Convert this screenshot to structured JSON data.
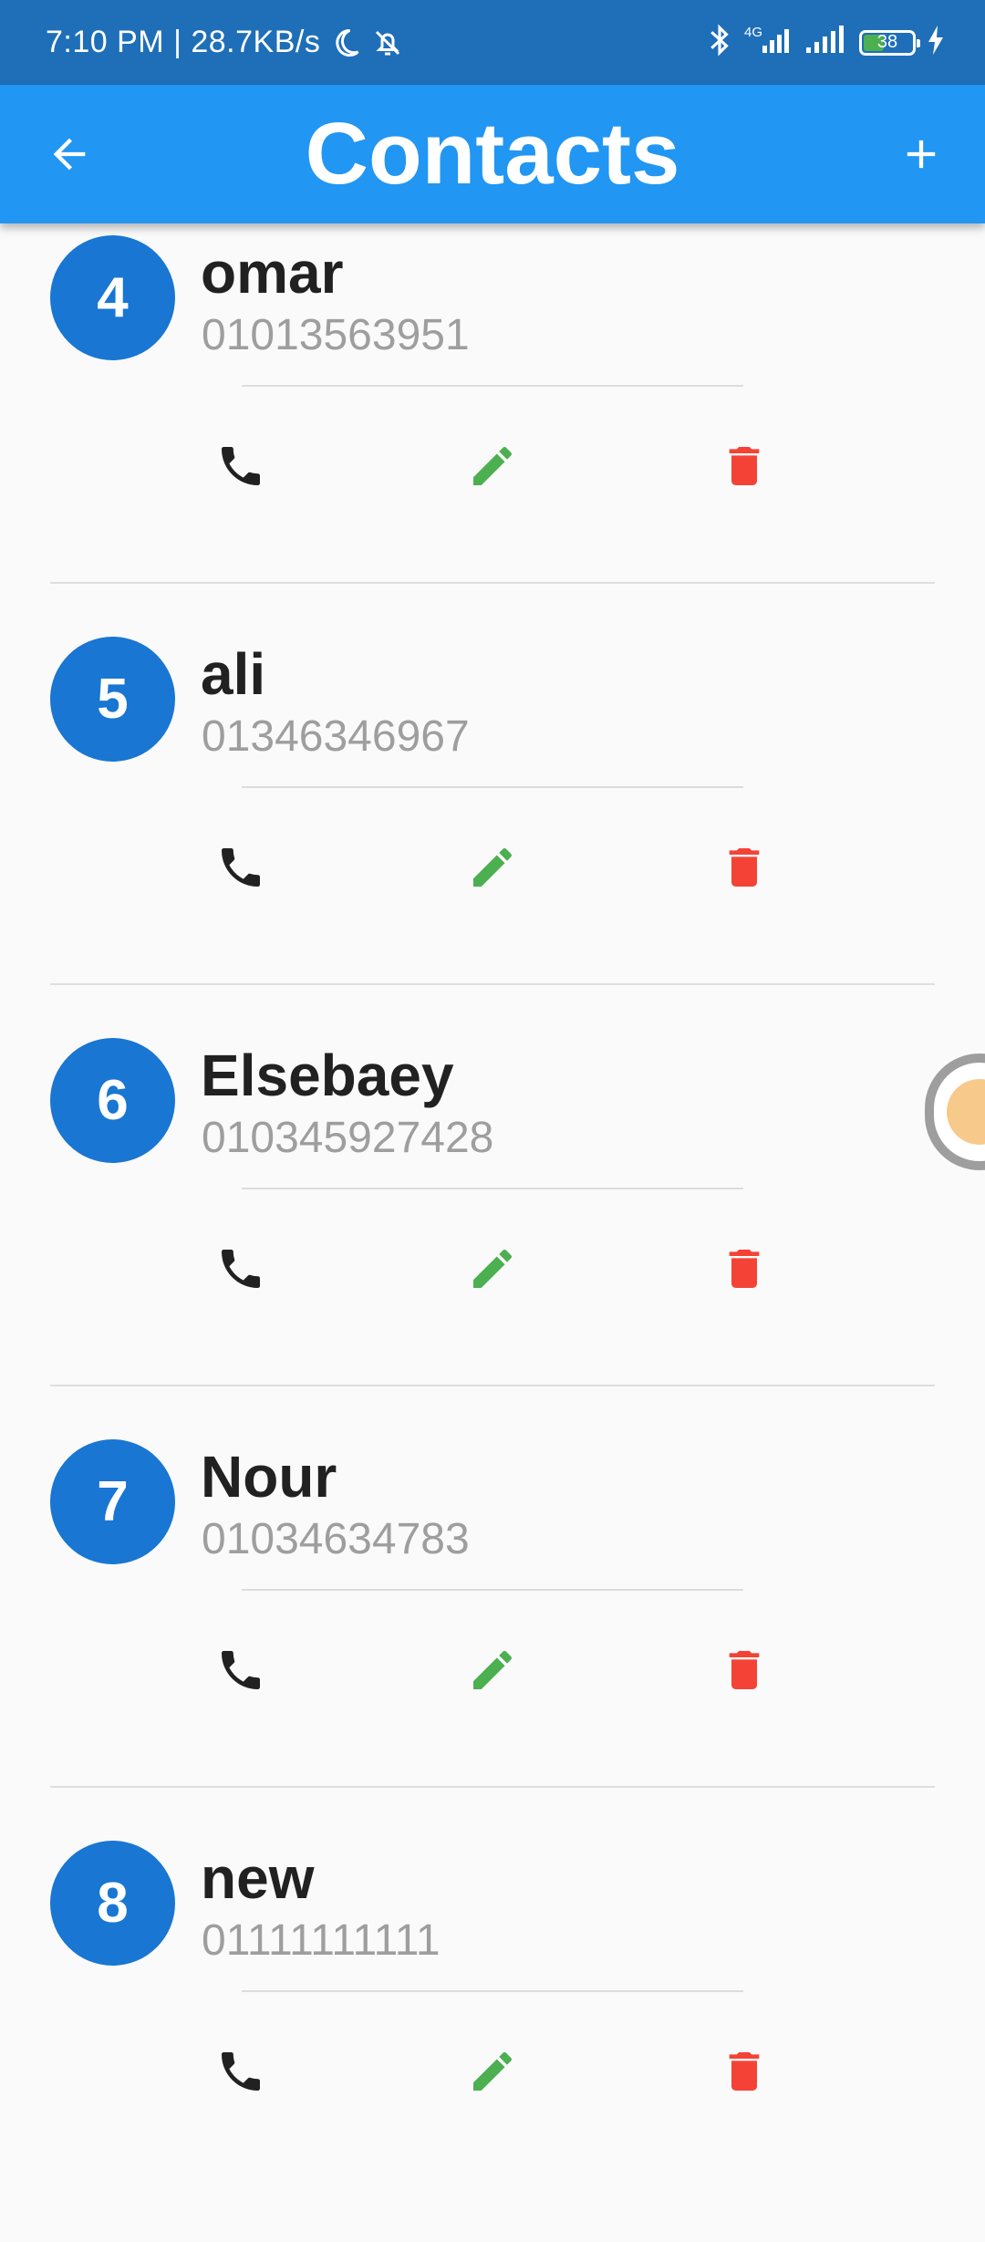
{
  "status_bar": {
    "time": "7:10 PM | 28.7KB/s",
    "network_tag": "4G",
    "battery_level": "38",
    "icons": [
      "moon-icon",
      "bell-off-icon",
      "bluetooth-icon",
      "signal-icon",
      "signal-icon",
      "battery-icon",
      "charging-bolt-icon"
    ]
  },
  "app_bar": {
    "title": "Contacts",
    "back_icon": "arrow-left-icon",
    "add_icon": "plus-icon",
    "background": "#2196f3"
  },
  "contacts": [
    {
      "number": "4",
      "name": "omar",
      "phone": "01013563951"
    },
    {
      "number": "5",
      "name": "ali",
      "phone": "01346346967"
    },
    {
      "number": "6",
      "name": "Elsebaey",
      "phone": "010345927428"
    },
    {
      "number": "7",
      "name": "Nour",
      "phone": "01034634783"
    },
    {
      "number": "8",
      "name": "new",
      "phone": "01111111111"
    }
  ],
  "actions": {
    "call_icon": "phone-icon",
    "edit_icon": "pencil-icon",
    "delete_icon": "trash-icon",
    "call_color": "#212121",
    "edit_color": "#4caf50",
    "delete_color": "#f44336",
    "badge_color": "#1976d2"
  }
}
